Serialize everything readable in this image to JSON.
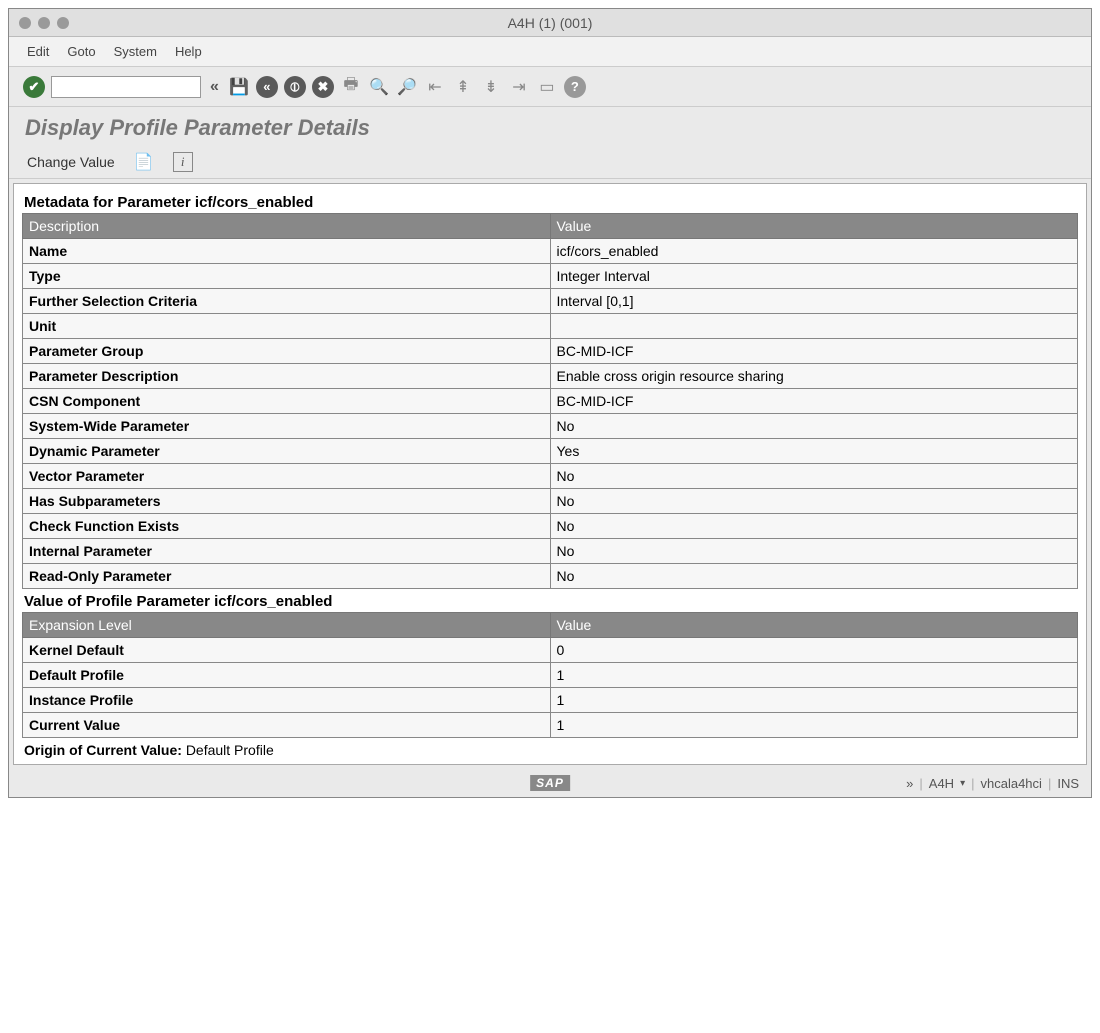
{
  "window": {
    "title": "A4H (1) (001)"
  },
  "menubar": {
    "items": [
      "Edit",
      "Goto",
      "System",
      "Help"
    ]
  },
  "screen": {
    "title": "Display Profile Parameter Details"
  },
  "appToolbar": {
    "changeValue": "Change Value"
  },
  "section1": {
    "title": "Metadata for Parameter icf/cors_enabled",
    "headers": [
      "Description",
      "Value"
    ],
    "rows": [
      {
        "label": "Name",
        "value": "icf/cors_enabled"
      },
      {
        "label": "Type",
        "value": "Integer Interval"
      },
      {
        "label": "Further Selection Criteria",
        "value": "Interval [0,1]"
      },
      {
        "label": "Unit",
        "value": ""
      },
      {
        "label": "Parameter Group",
        "value": "BC-MID-ICF"
      },
      {
        "label": "Parameter Description",
        "value": "Enable cross origin resource sharing"
      },
      {
        "label": "CSN Component",
        "value": "BC-MID-ICF"
      },
      {
        "label": "System-Wide Parameter",
        "value": "No"
      },
      {
        "label": "Dynamic Parameter",
        "value": "Yes"
      },
      {
        "label": "Vector Parameter",
        "value": "No"
      },
      {
        "label": "Has Subparameters",
        "value": "No"
      },
      {
        "label": "Check Function Exists",
        "value": "No"
      },
      {
        "label": "Internal Parameter",
        "value": "No"
      },
      {
        "label": "Read-Only Parameter",
        "value": "No"
      }
    ]
  },
  "section2": {
    "title": "Value of Profile Parameter icf/cors_enabled",
    "headers": [
      "Expansion Level",
      "Value"
    ],
    "rows": [
      {
        "label": "Kernel Default",
        "value": "0"
      },
      {
        "label": "Default Profile",
        "value": "1"
      },
      {
        "label": "Instance Profile",
        "value": "1"
      },
      {
        "label": "Current Value",
        "value": "1"
      }
    ]
  },
  "origin": {
    "label": "Origin of Current Value",
    "value": "Default Profile"
  },
  "status": {
    "system": "A4H",
    "host": "vhcala4hci",
    "mode": "INS",
    "logo": "SAP"
  }
}
